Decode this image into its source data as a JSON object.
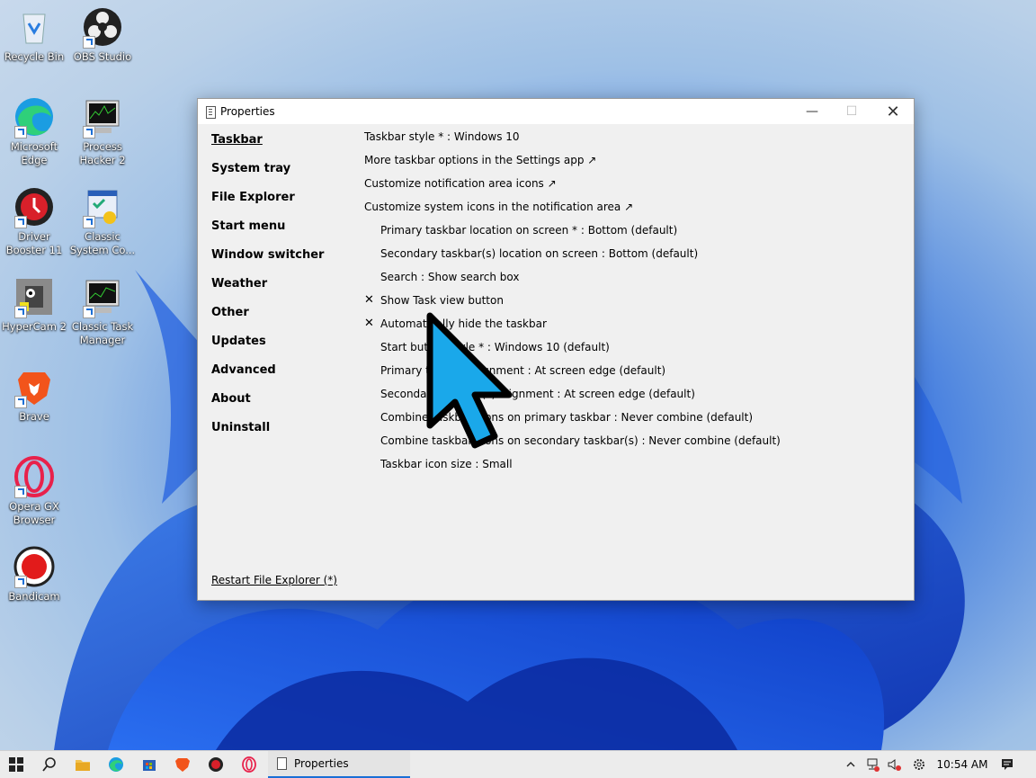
{
  "desktop": {
    "icons": [
      {
        "label": "Recycle Bin",
        "name": "recycle-bin-icon"
      },
      {
        "label": "OBS Studio",
        "name": "obs-studio-icon"
      },
      {
        "label": "Microsoft Edge",
        "name": "microsoft-edge-icon"
      },
      {
        "label": "Process Hacker 2",
        "name": "process-hacker-icon"
      },
      {
        "label": "Driver Booster 11",
        "name": "driver-booster-icon"
      },
      {
        "label": "Classic System Co...",
        "name": "classic-system-config-icon"
      },
      {
        "label": "HyperCam 2",
        "name": "hypercam-icon"
      },
      {
        "label": "Classic Task Manager",
        "name": "classic-task-manager-icon"
      },
      {
        "label": "Brave",
        "name": "brave-icon"
      },
      {
        "label": "Opera GX Browser",
        "name": "opera-gx-icon"
      },
      {
        "label": "Bandicam",
        "name": "bandicam-icon"
      }
    ]
  },
  "window": {
    "title": "Properties",
    "controls": {
      "minimize": "—",
      "maximize": "☐",
      "close": "✕"
    },
    "nav": [
      {
        "label": "Taskbar",
        "active": true
      },
      {
        "label": "System tray"
      },
      {
        "label": "File Explorer"
      },
      {
        "label": "Start menu"
      },
      {
        "label": "Window switcher"
      },
      {
        "label": "Weather"
      },
      {
        "label": "Other"
      },
      {
        "label": "Updates"
      },
      {
        "label": "Advanced"
      },
      {
        "label": "About"
      },
      {
        "label": "Uninstall"
      }
    ],
    "settings": [
      {
        "text": "Taskbar style * : Windows 10"
      },
      {
        "text": "More taskbar options in the Settings app ↗"
      },
      {
        "text": "Customize notification area icons ↗"
      },
      {
        "text": "Customize system icons in the notification area ↗"
      },
      {
        "text": "Primary taskbar location on screen * : Bottom (default)"
      },
      {
        "text": "Secondary taskbar(s) location on screen : Bottom (default)"
      },
      {
        "text": "Search : Show search box"
      },
      {
        "text": "Show Task view button",
        "check": "✕"
      },
      {
        "text": "Automatically hide the taskbar",
        "check": "✕"
      },
      {
        "text": "Start button style * : Windows 10 (default)"
      },
      {
        "text": "Primary taskbar alignment : At screen edge (default)"
      },
      {
        "text": "Secondary taskbar(s) alignment : At screen edge (default)"
      },
      {
        "text": "Combine taskbar icons on primary taskbar : Never combine (default)"
      },
      {
        "text": "Combine taskbar icons on secondary taskbar(s) : Never combine (default)"
      },
      {
        "text": "Taskbar icon size : Small"
      }
    ],
    "restart_link": "Restart File Explorer (*)"
  },
  "taskbar": {
    "active_app": "Properties",
    "clock": "10:54 AM",
    "accent": "#1a6fd6"
  }
}
